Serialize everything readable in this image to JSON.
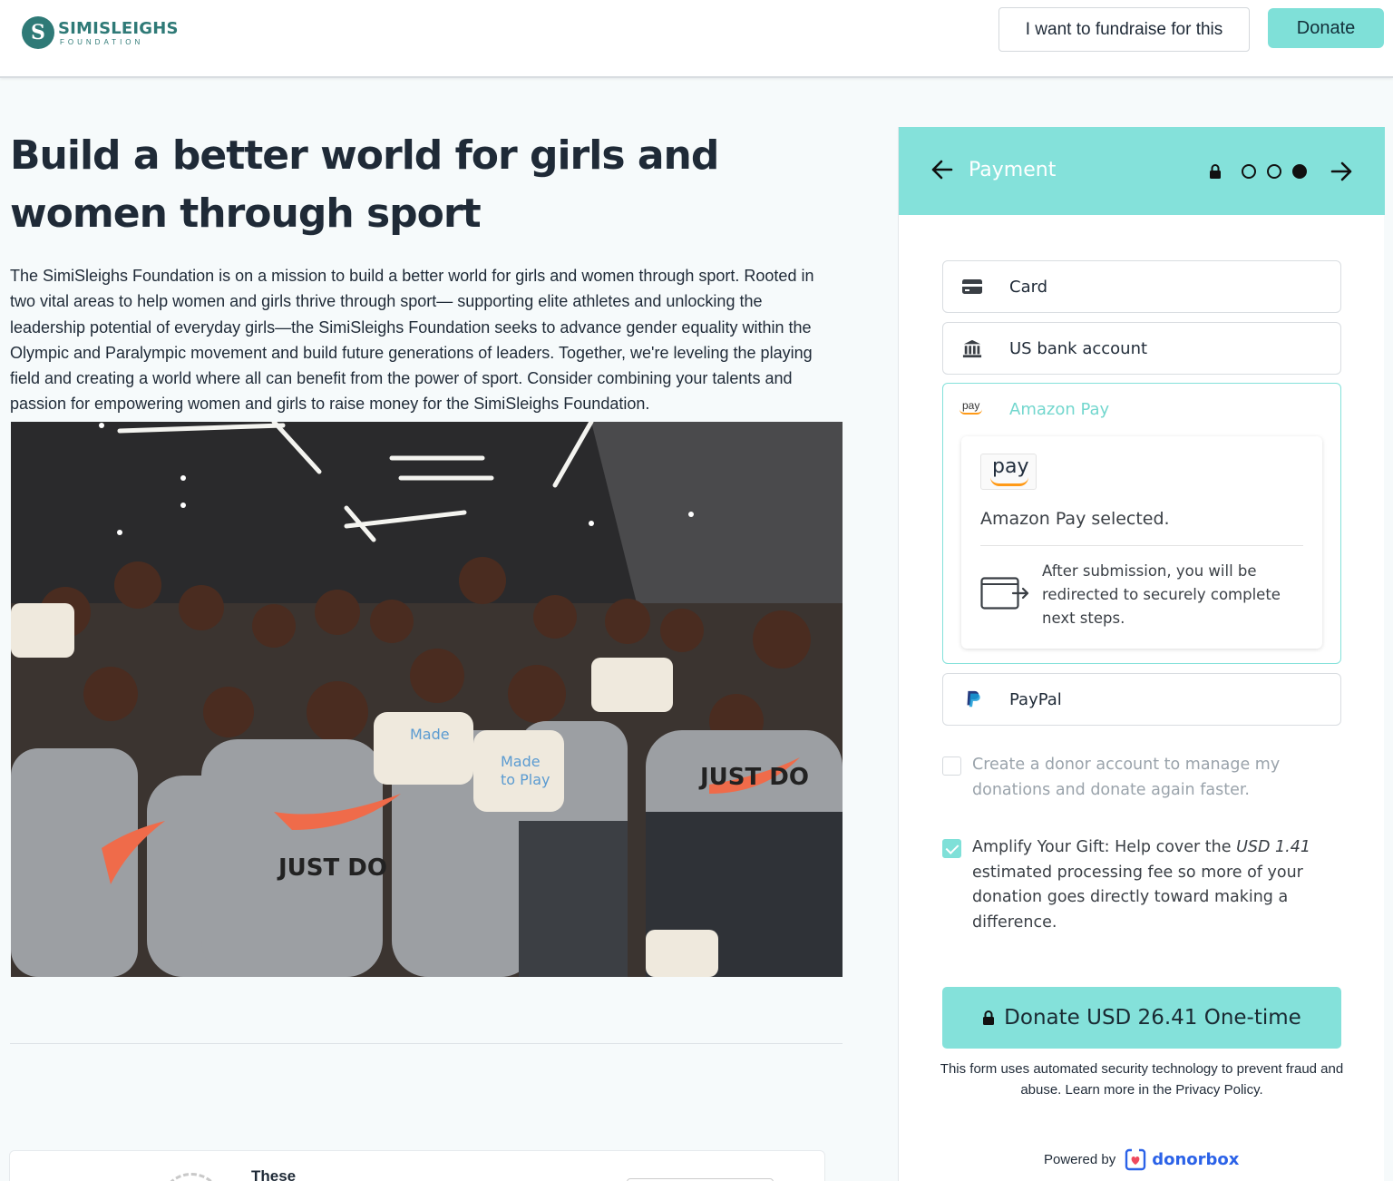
{
  "header": {
    "logo_mark": "S",
    "logo_name": "SIMISLEIGHS",
    "logo_sub": "FOUNDATION",
    "fundraise_label": "I want to fundraise for this",
    "donate_label": "Donate"
  },
  "main": {
    "title": "Build a better world for girls and women through sport",
    "intro": "The SimiSleighs Foundation is on a mission to build a better world for girls and women through sport. Rooted in two vital areas to help women and girls thrive through sport— supporting elite athletes and unlocking the leadership potential of everyday girls—the SimiSleighs Foundation seeks to advance gender equality within the Olympic and Paralympic movement and build future generations of leaders. Together, we're leveling the playing field and creating a world where all can benefit from the power of sport. Consider combining your talents and passion for empowering women and girls to raise money for the SimiSleighs Foundation.",
    "bottom_card_text": "These"
  },
  "panel": {
    "title": "Payment",
    "steps": [
      false,
      false,
      true
    ],
    "options": {
      "card": "Card",
      "bank": "US bank account",
      "amazon": "Amazon Pay",
      "amazon_icon_text": "pay",
      "paypal": "PayPal"
    },
    "amazon_box": {
      "pay_text": "pay",
      "selected": "Amazon Pay selected.",
      "note": "After submission, you will be redirected to securely complete next steps."
    },
    "donor_account": {
      "checked": false,
      "text": "Create a donor account to manage my donations and donate again faster."
    },
    "amplify": {
      "checked": true,
      "pre": "Amplify Your Gift: Help cover the ",
      "amount": "USD 1.41",
      "post": " estimated processing fee so more of your donation goes directly toward making a difference."
    },
    "donate_button": "Donate USD 26.41 One-time",
    "legal": "This form uses automated security technology to prevent fraud and abuse. Learn more in the Privacy Policy.",
    "powered_by": "Powered by",
    "brand": "donorbox"
  },
  "colors": {
    "accent": "#84e1da",
    "brand": "#2f7a77",
    "donorbox_blue": "#2b62e8"
  }
}
